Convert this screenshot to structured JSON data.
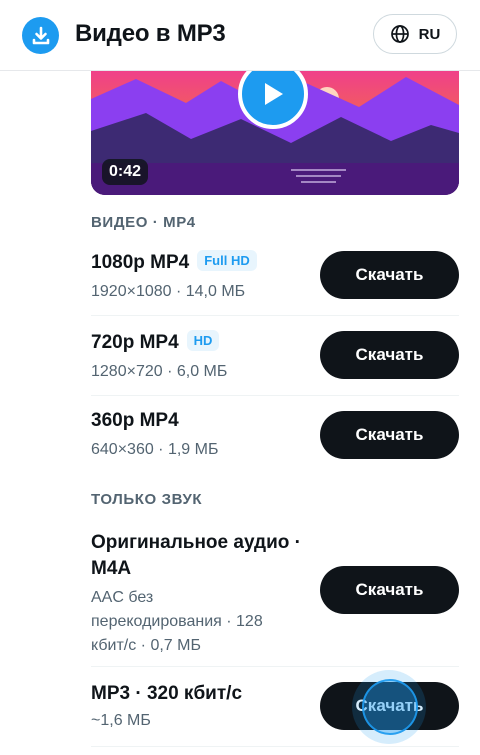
{
  "header": {
    "title": "Видео в MP3",
    "language": "RU",
    "logo_icon": "download-icon",
    "language_icon": "globe-icon"
  },
  "video": {
    "duration": "0:42",
    "play_icon": "play-icon"
  },
  "sections": {
    "video_label": "ВИДЕО · MP4",
    "audio_label": "ТОЛЬКО ЗВУК"
  },
  "video_formats": [
    {
      "title": "1080p MP4",
      "badge": "Full HD",
      "meta": "1920×1080 · 14,0 МБ",
      "button": "Скачать"
    },
    {
      "title": "720p MP4",
      "badge": "HD",
      "meta": "1280×720 · 6,0 МБ",
      "button": "Скачать"
    },
    {
      "title": "360p MP4",
      "badge": "",
      "meta": "640×360 · 1,9 МБ",
      "button": "Скачать"
    }
  ],
  "audio_formats": [
    {
      "title_line1": "Оригинальное аудио ·",
      "title_line2": "M4A",
      "meta_line1": "AAC без",
      "meta_line2": "перекодирования · 128",
      "meta_line3": "кбит/с · 0,7 МБ",
      "button": "Скачать"
    },
    {
      "title": "MP3 · 320 кбит/с",
      "meta": "~1,6 МБ",
      "button": "Скачать"
    }
  ],
  "colors": {
    "accent": "#1d9bf0",
    "button_bg": "#0f1419",
    "muted_text": "#536471"
  }
}
